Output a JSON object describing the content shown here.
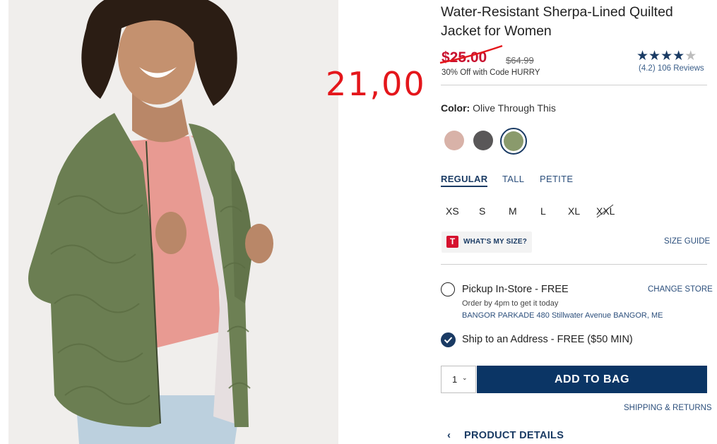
{
  "product": {
    "title": "Water-Resistant Sherpa-Lined Quilted Jacket for Women",
    "sale_price": "$25.00",
    "original_price": "$64.99",
    "promo": "30% Off with Code HURRY",
    "rating_value": 4.2,
    "rating_max": 5,
    "reviews": "(4.2) 106 Reviews"
  },
  "annotation": {
    "text": "21,00",
    "color": "#e4161b"
  },
  "color": {
    "label": "Color:",
    "selected": "Olive Through This",
    "swatches": [
      {
        "name": "blush",
        "hex": "#d8b2a8"
      },
      {
        "name": "charcoal",
        "hex": "#595758"
      },
      {
        "name": "olive",
        "hex": "#8a9a6c",
        "selected": true
      }
    ]
  },
  "fit_tabs": [
    "REGULAR",
    "TALL",
    "PETITE"
  ],
  "sizes": [
    "XS",
    "S",
    "M",
    "L",
    "XL",
    "XXL"
  ],
  "unavailable_sizes": [
    "XXL"
  ],
  "size_help": {
    "badge": "T",
    "whats_my_size": "WHAT'S MY SIZE?",
    "size_guide": "SIZE GUIDE"
  },
  "fulfillment": {
    "pickup_label": "Pickup In-Store - FREE",
    "change_store": "CHANGE STORE",
    "pickup_note": "Order by 4pm to get it today",
    "store_address": "BANGOR PARKADE 480 Stillwater Avenue  BANGOR, ME",
    "ship_label": "Ship to an Address - FREE ($50 MIN)",
    "ship_selected": true
  },
  "cart": {
    "quantity": "1",
    "add_to_bag": "ADD TO BAG"
  },
  "links": {
    "shipping_returns": "SHIPPING & RETURNS",
    "product_details": "PRODUCT DETAILS"
  },
  "colors": {
    "brand_navy": "#0b3565",
    "sale_red": "#c8102e"
  }
}
